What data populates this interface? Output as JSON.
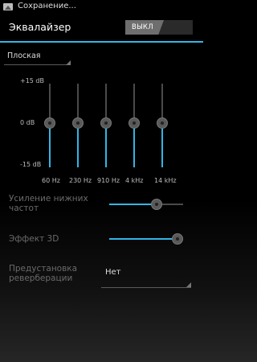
{
  "status_bar": {
    "notification_text": "Сохранение...",
    "notification_icon": "image-icon"
  },
  "action_bar": {
    "title": "Эквалайзер",
    "toggle_label": "ВЫКЛ"
  },
  "preset": {
    "selected": "Плоская"
  },
  "eq": {
    "db_labels": {
      "max": "+15 dB",
      "mid": "0 dB",
      "min": "-15 dB"
    },
    "bands": [
      {
        "freq": "60 Hz",
        "gain_db": 0
      },
      {
        "freq": "230 Hz",
        "gain_db": 0
      },
      {
        "freq": "910 Hz",
        "gain_db": 0
      },
      {
        "freq": "4 kHz",
        "gain_db": 0
      },
      {
        "freq": "14 kHz",
        "gain_db": 0
      }
    ]
  },
  "bass_boost": {
    "label": "Усиление нижних частот",
    "value": 0.7
  },
  "effect_3d": {
    "label": "Эффект 3D",
    "value": 1.0
  },
  "reverb": {
    "label": "Предустановка реверберации",
    "value": "Нет"
  },
  "accent_color": "#33b5e5"
}
